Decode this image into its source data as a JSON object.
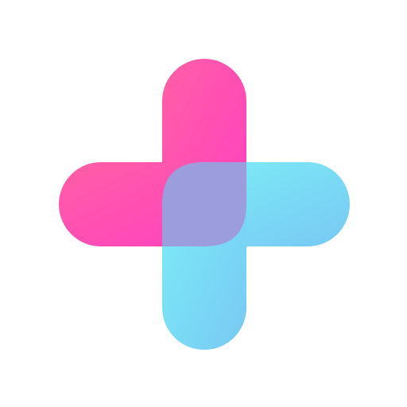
{
  "icon": {
    "name": "medical-plus-logo",
    "colors": {
      "background": "#ffffff",
      "pink_start": "#ff5fa6",
      "pink_end": "#ff3fc0",
      "cyan_start": "#7df0f6",
      "cyan_end": "#78c8f4",
      "overlap": "#9b9ddd"
    }
  }
}
